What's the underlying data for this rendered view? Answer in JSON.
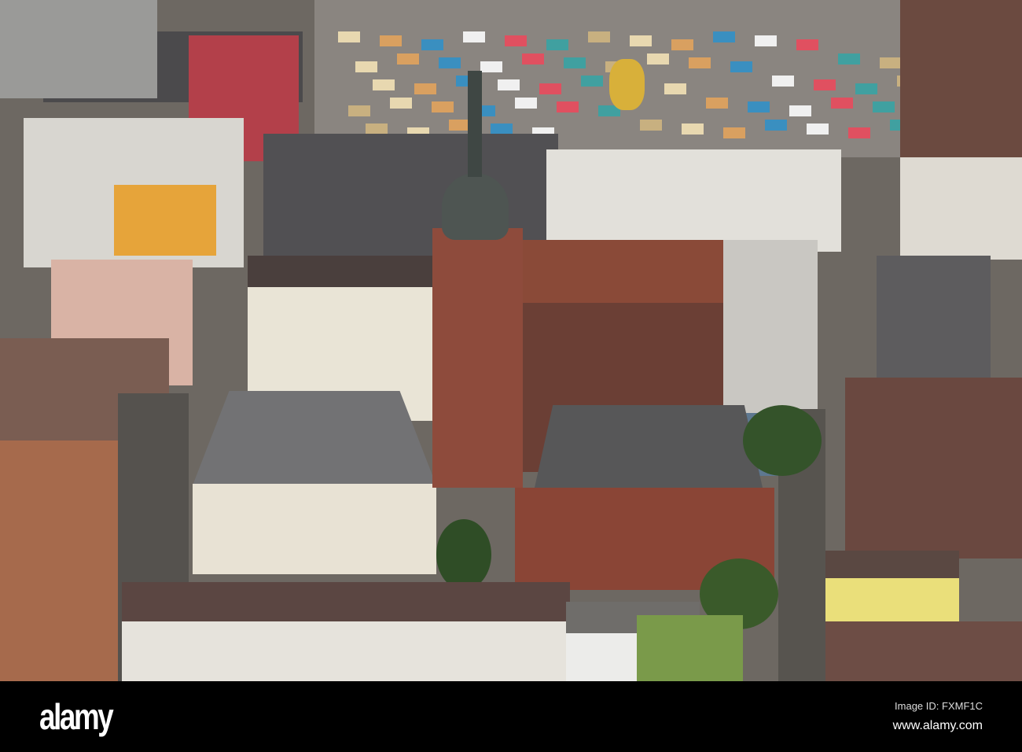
{
  "watermark": {
    "logo": "alamy",
    "image_id": "Image ID: FXMF1C",
    "site": "www.alamy.com"
  },
  "colors": {
    "roof_brown": "#7a4a3a",
    "roof_grey": "#5c5c5e",
    "sandstone": "#8e4b3c",
    "plaza": "#8a8580",
    "bar": "#000000"
  }
}
